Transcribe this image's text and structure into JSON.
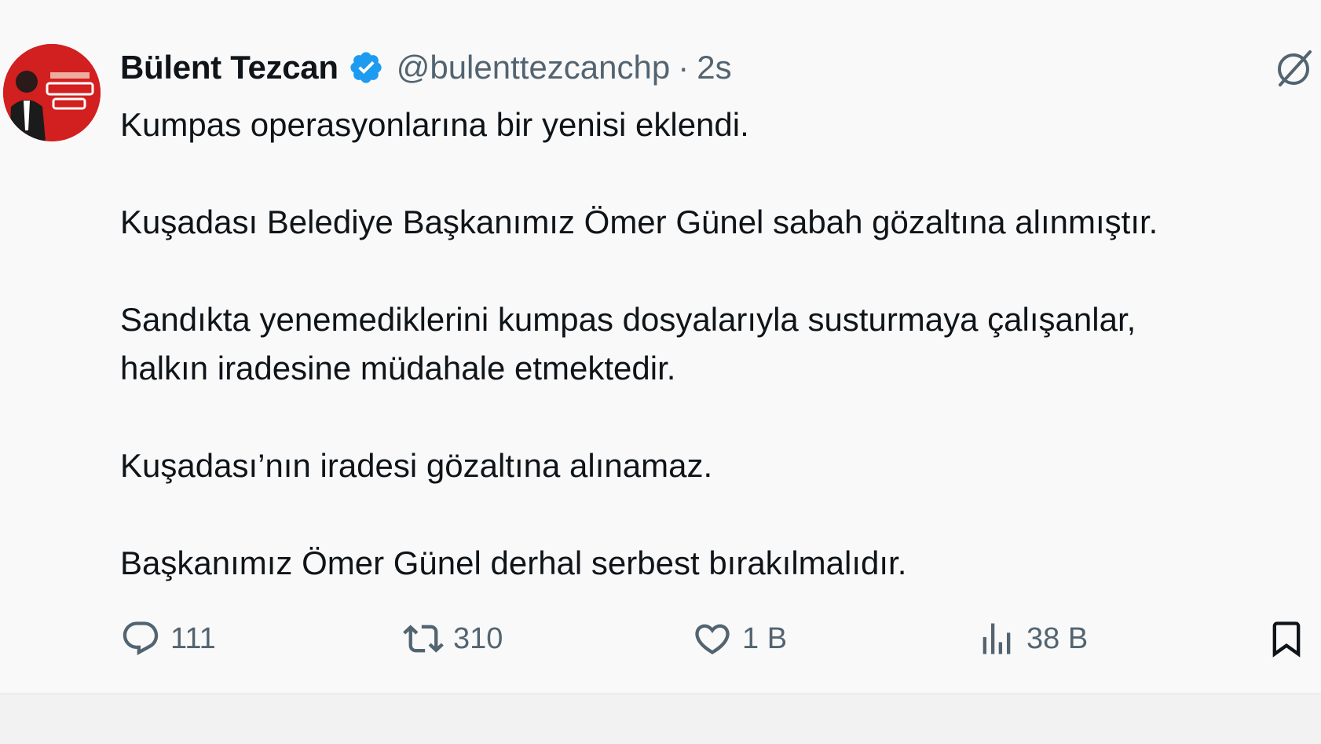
{
  "author": {
    "name": "Bülent Tezcan",
    "handle": "@bulenttezcanchp",
    "separator": "·",
    "time": "2s",
    "avatar_icon": "avatar-poster-icon",
    "verified_color": "#1d9bf0"
  },
  "tweet": {
    "paragraphs": [
      "Kumpas operasyonlarına bir yenisi eklendi.",
      "Kuşadası Belediye Başkanımız Ömer Günel sabah gözaltına alınmıştır.",
      "Sandıkta yenemediklerini kumpas dosyalarıyla susturmaya çalışanlar,",
      "halkın iradesine müdahale etmektedir.",
      "Kuşadası’nın iradesi gözaltına alınamaz.",
      "Başkanımız Ömer Günel derhal serbest bırakılmalıdır."
    ]
  },
  "actions": {
    "replies": "111",
    "retweets": "310",
    "likes": "1 B",
    "views": "38 B"
  },
  "colors": {
    "text": "#0f1419",
    "muted": "#536471",
    "background": "#f9f9f9",
    "avatar": "#d21f1f"
  }
}
